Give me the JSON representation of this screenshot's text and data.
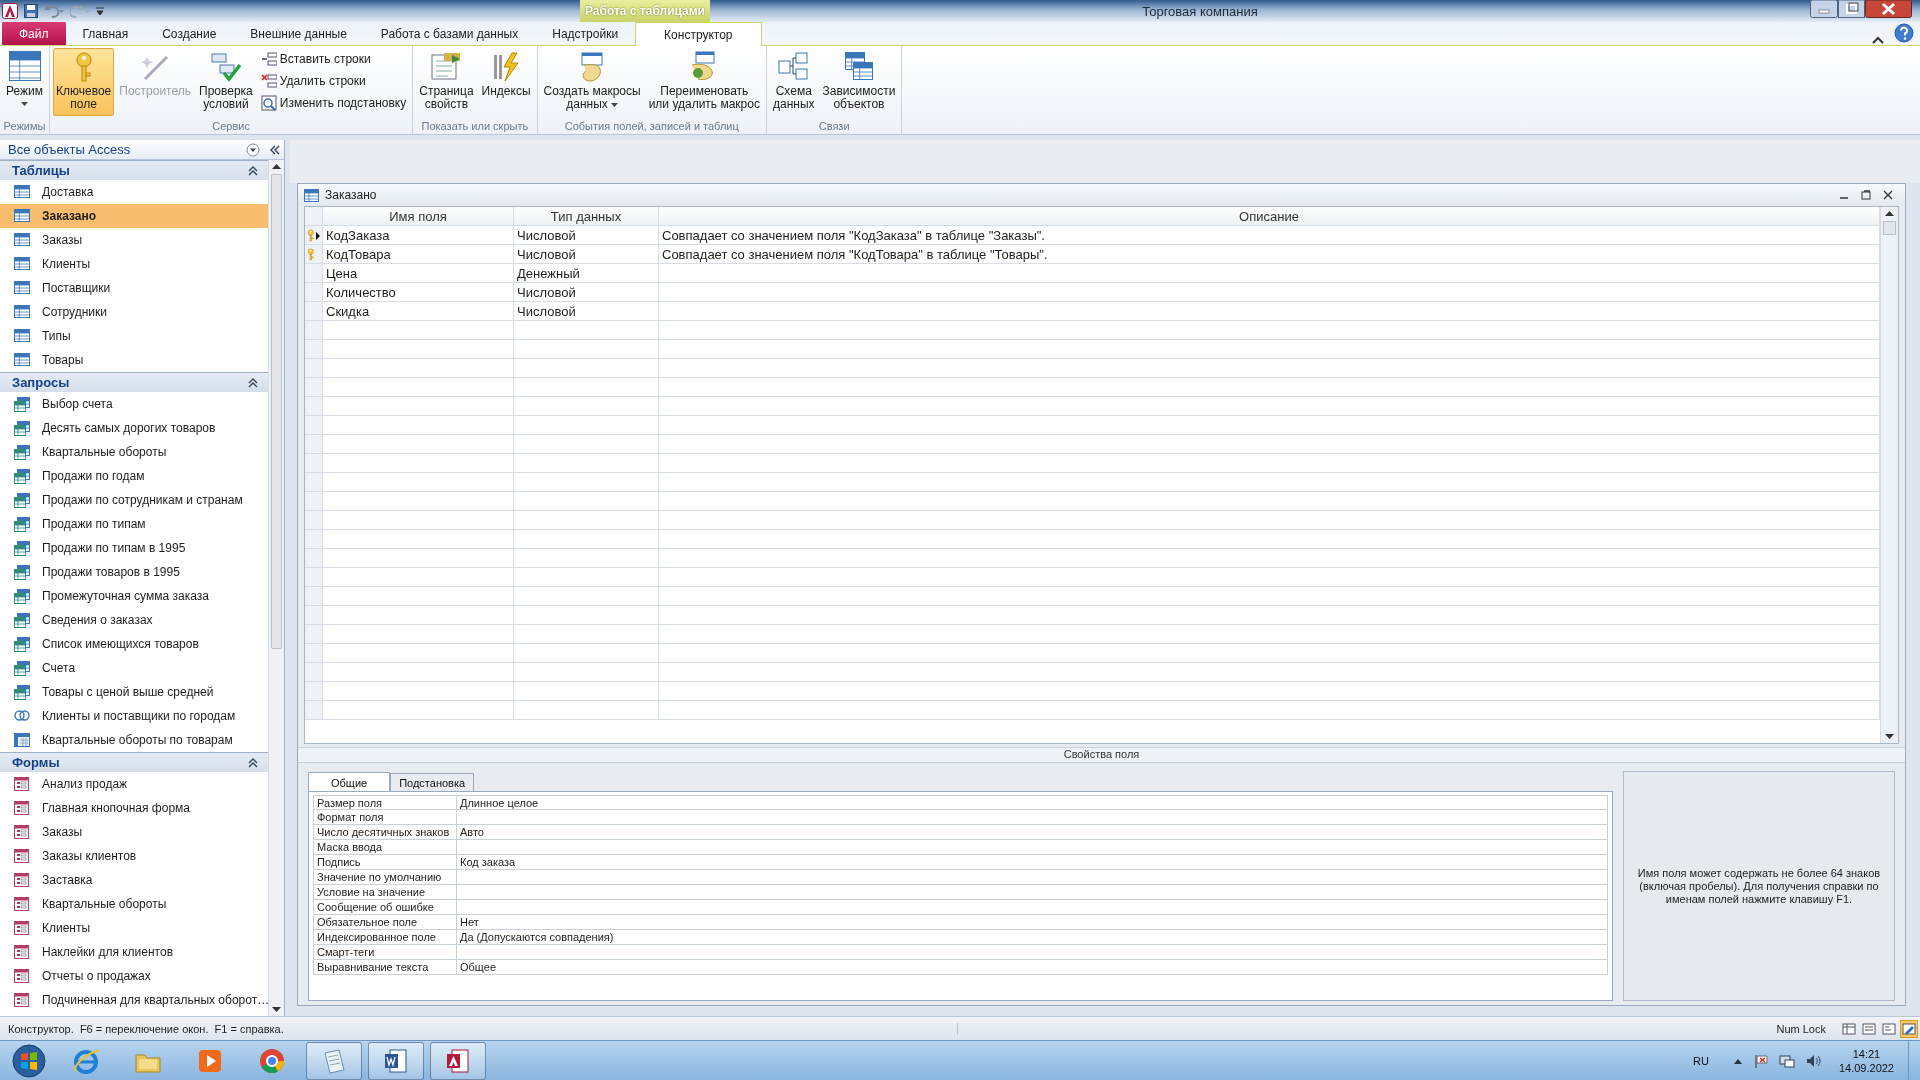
{
  "window": {
    "title": "Торговая компания",
    "context_group": "Работа с таблицами"
  },
  "ribbon_tabs": [
    {
      "label": "Файл",
      "kind": "file",
      "selected": false
    },
    {
      "label": "Главная",
      "kind": "tab",
      "selected": false
    },
    {
      "label": "Создание",
      "kind": "tab",
      "selected": false
    },
    {
      "label": "Внешние данные",
      "kind": "tab",
      "selected": false
    },
    {
      "label": "Работа с базами данных",
      "kind": "tab",
      "selected": false
    },
    {
      "label": "Надстройки",
      "kind": "tab",
      "selected": false
    },
    {
      "label": "Конструктор",
      "kind": "context",
      "selected": true
    }
  ],
  "ribbon_groups": [
    {
      "label": "Режимы",
      "buttons": [
        {
          "label": "Режим",
          "kind": "large",
          "dropdown": true,
          "on": false,
          "disabled": false
        }
      ]
    },
    {
      "label": "Сервис",
      "buttons": [
        {
          "label": "Ключевое\nполе",
          "kind": "large",
          "dropdown": false,
          "on": true,
          "disabled": false
        },
        {
          "label": "Построитель",
          "kind": "large",
          "dropdown": false,
          "on": false,
          "disabled": true
        },
        {
          "label": "Проверка\nусловий",
          "kind": "large",
          "dropdown": false,
          "on": false,
          "disabled": false
        },
        {
          "label": "Вставить строки",
          "kind": "small",
          "dropdown": false,
          "on": false,
          "disabled": false
        },
        {
          "label": "Удалить строки",
          "kind": "small",
          "dropdown": false,
          "on": false,
          "disabled": false
        },
        {
          "label": "Изменить подстановку",
          "kind": "small",
          "dropdown": false,
          "on": false,
          "disabled": false
        }
      ]
    },
    {
      "label": "Показать или скрыть",
      "buttons": [
        {
          "label": "Страница\nсвойств",
          "kind": "large",
          "dropdown": false,
          "on": false,
          "disabled": false
        },
        {
          "label": "Индексы",
          "kind": "large",
          "dropdown": false,
          "on": false,
          "disabled": false
        }
      ]
    },
    {
      "label": "События полей, записей и таблиц",
      "buttons": [
        {
          "label": "Создать макросы\nданных",
          "kind": "large",
          "dropdown": true,
          "on": false,
          "disabled": false
        },
        {
          "label": "Переименовать\nили удалить макрос",
          "kind": "large",
          "dropdown": false,
          "on": false,
          "disabled": false
        }
      ]
    },
    {
      "label": "Связи",
      "buttons": [
        {
          "label": "Схема\nданных",
          "kind": "large",
          "dropdown": false,
          "on": false,
          "disabled": false
        },
        {
          "label": "Зависимости\nобъектов",
          "kind": "large",
          "dropdown": false,
          "on": false,
          "disabled": false
        }
      ]
    }
  ],
  "nav_pane": {
    "title": "Все объекты Access",
    "groups": [
      {
        "title": "Таблицы",
        "expanded": true,
        "items": [
          {
            "label": "Доставка",
            "kind": "table",
            "selected": false
          },
          {
            "label": "Заказано",
            "kind": "table",
            "selected": true
          },
          {
            "label": "Заказы",
            "kind": "table",
            "selected": false
          },
          {
            "label": "Клиенты",
            "kind": "table",
            "selected": false
          },
          {
            "label": "Поставщики",
            "kind": "table",
            "selected": false
          },
          {
            "label": "Сотрудники",
            "kind": "table",
            "selected": false
          },
          {
            "label": "Типы",
            "kind": "table",
            "selected": false
          },
          {
            "label": "Товары",
            "kind": "table",
            "selected": false
          }
        ]
      },
      {
        "title": "Запросы",
        "expanded": true,
        "items": [
          {
            "label": "Выбор счета",
            "kind": "query",
            "selected": false
          },
          {
            "label": "Десять самых дорогих товаров",
            "kind": "query",
            "selected": false
          },
          {
            "label": "Квартальные обороты",
            "kind": "query",
            "selected": false
          },
          {
            "label": "Продажи по годам",
            "kind": "query",
            "selected": false
          },
          {
            "label": "Продажи по сотрудникам и странам",
            "kind": "query",
            "selected": false
          },
          {
            "label": "Продажи по типам",
            "kind": "query",
            "selected": false
          },
          {
            "label": "Продажи по типам в 1995",
            "kind": "query",
            "selected": false
          },
          {
            "label": "Продажи товаров в 1995",
            "kind": "query",
            "selected": false
          },
          {
            "label": "Промежуточная сумма заказа",
            "kind": "query",
            "selected": false
          },
          {
            "label": "Сведения о заказах",
            "kind": "query",
            "selected": false
          },
          {
            "label": "Список имеющихся товаров",
            "kind": "query",
            "selected": false
          },
          {
            "label": "Счета",
            "kind": "query",
            "selected": false
          },
          {
            "label": "Товары с ценой выше средней",
            "kind": "query",
            "selected": false
          },
          {
            "label": "Клиенты и поставщики по городам",
            "kind": "union",
            "selected": false
          },
          {
            "label": "Квартальные обороты по товарам",
            "kind": "crosstab",
            "selected": false
          }
        ]
      },
      {
        "title": "Формы",
        "expanded": true,
        "items": [
          {
            "label": "Анализ продаж",
            "kind": "form",
            "selected": false
          },
          {
            "label": "Главная кнопочная форма",
            "kind": "form",
            "selected": false
          },
          {
            "label": "Заказы",
            "kind": "form",
            "selected": false
          },
          {
            "label": "Заказы клиентов",
            "kind": "form",
            "selected": false
          },
          {
            "label": "Заставка",
            "kind": "form",
            "selected": false
          },
          {
            "label": "Квартальные обороты",
            "kind": "form",
            "selected": false
          },
          {
            "label": "Клиенты",
            "kind": "form",
            "selected": false
          },
          {
            "label": "Наклейки для клиентов",
            "kind": "form",
            "selected": false
          },
          {
            "label": "Отчеты о продажах",
            "kind": "form",
            "selected": false
          },
          {
            "label": "Подчиненная для квартальных оборот…",
            "kind": "form",
            "selected": false
          }
        ]
      }
    ]
  },
  "document": {
    "title": "Заказано",
    "columns": [
      "Имя поля",
      "Тип данных",
      "Описание"
    ],
    "rows": [
      {
        "name": "КодЗаказа",
        "type": "Числовой",
        "description": "Совпадает со значением поля \"КодЗаказа\" в таблице \"Заказы\".",
        "key": true,
        "current": true
      },
      {
        "name": "КодТовара",
        "type": "Числовой",
        "description": "Совпадает со значением поля \"КодТовара\" в таблице \"Товары\".",
        "key": true,
        "current": false
      },
      {
        "name": "Цена",
        "type": "Денежный",
        "key": false,
        "current": false
      },
      {
        "name": "Количество",
        "type": "Числовой",
        "key": false,
        "current": false
      },
      {
        "name": "Скидка",
        "type": "Числовой",
        "key": false,
        "current": false
      }
    ],
    "properties_title": "Свойства поля",
    "property_tabs": [
      {
        "label": "Общие",
        "selected": true
      },
      {
        "label": "Подстановка",
        "selected": false
      }
    ],
    "properties": [
      {
        "label": "Размер поля",
        "value": "Длинное целое"
      },
      {
        "label": "Формат поля"
      },
      {
        "label": "Число десятичных знаков",
        "value": "Авто"
      },
      {
        "label": "Маска ввода"
      },
      {
        "label": "Подпись",
        "value": "Код заказа"
      },
      {
        "label": "Значение по умолчанию"
      },
      {
        "label": "Условие на значение"
      },
      {
        "label": "Сообщение об ошибке"
      },
      {
        "label": "Обязательное поле",
        "value": "Нет"
      },
      {
        "label": "Индексированное поле",
        "value": "Да (Допускаются совпадения)"
      },
      {
        "label": "Смарт-теги"
      },
      {
        "label": "Выравнивание текста",
        "value": "Общее"
      }
    ],
    "help": "Имя поля может содержать не более 64 знаков (включая пробелы). Для получения справки по именам полей нажмите клавишу F1."
  },
  "status_bar": {
    "text": "Конструктор.  F6 = переключение окон.  F1 = справка.",
    "indicator": "Num Lock",
    "view_buttons": [
      {
        "selected": false
      },
      {
        "selected": false
      },
      {
        "selected": false
      },
      {
        "selected": true
      }
    ]
  },
  "taskbar": {
    "apps": [
      {
        "kind": "ie",
        "running": false
      },
      {
        "kind": "explorer",
        "running": false
      },
      {
        "kind": "media",
        "running": false
      },
      {
        "kind": "chrome",
        "running": false
      },
      {
        "kind": "notes",
        "running": true
      },
      {
        "kind": "word",
        "running": true
      },
      {
        "kind": "access",
        "running": true
      }
    ],
    "language": "RU",
    "time": "14:21",
    "date": "14.09.2022"
  }
}
